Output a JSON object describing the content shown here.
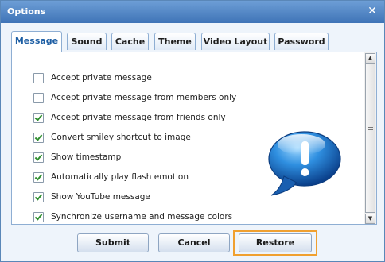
{
  "window": {
    "title": "Options",
    "close_icon": "close-icon"
  },
  "tabs": [
    {
      "label": "Message",
      "active": true
    },
    {
      "label": "Sound",
      "active": false
    },
    {
      "label": "Cache",
      "active": false
    },
    {
      "label": "Theme",
      "active": false
    },
    {
      "label": "Video Layout",
      "active": false
    },
    {
      "label": "Password",
      "active": false
    }
  ],
  "options": [
    {
      "label": "Accept private message",
      "checked": false
    },
    {
      "label": "Accept private message from members only",
      "checked": false
    },
    {
      "label": "Accept private message from friends only",
      "checked": true
    },
    {
      "label": "Convert smiley shortcut to image",
      "checked": true
    },
    {
      "label": "Show timestamp",
      "checked": true
    },
    {
      "label": "Automatically play flash emotion",
      "checked": true
    },
    {
      "label": "Show YouTube message",
      "checked": true
    },
    {
      "label": "Synchronize username and message colors",
      "checked": true
    }
  ],
  "buttons": {
    "submit": "Submit",
    "cancel": "Cancel",
    "restore": "Restore"
  },
  "colors": {
    "titlebar": "#4b80c0",
    "accent": "#f0a030",
    "check": "#2f8f2f"
  },
  "illustration": "exclamation-speech-bubble-icon"
}
